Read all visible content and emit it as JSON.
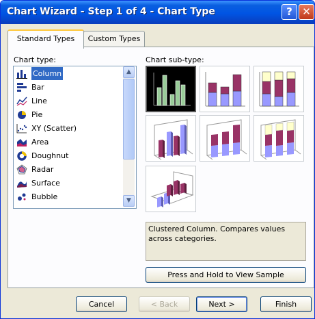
{
  "window": {
    "title": "Chart Wizard - Step 1 of 4 - Chart Type",
    "help_glyph": "?",
    "close_glyph": "✕"
  },
  "tabs": [
    {
      "label": "Standard Types",
      "active": true
    },
    {
      "label": "Custom Types",
      "active": false
    }
  ],
  "chart_type": {
    "label": "Chart type:",
    "items": [
      {
        "label": "Column",
        "icon": "column-chart-icon",
        "selected": true
      },
      {
        "label": "Bar",
        "icon": "bar-chart-icon"
      },
      {
        "label": "Line",
        "icon": "line-chart-icon"
      },
      {
        "label": "Pie",
        "icon": "pie-chart-icon"
      },
      {
        "label": "XY (Scatter)",
        "icon": "scatter-chart-icon"
      },
      {
        "label": "Area",
        "icon": "area-chart-icon"
      },
      {
        "label": "Doughnut",
        "icon": "doughnut-chart-icon"
      },
      {
        "label": "Radar",
        "icon": "radar-chart-icon"
      },
      {
        "label": "Surface",
        "icon": "surface-chart-icon"
      },
      {
        "label": "Bubble",
        "icon": "bubble-chart-icon"
      }
    ]
  },
  "chart_subtype": {
    "label": "Chart sub-type:",
    "selected": "Clustered Column",
    "options": [
      "clustered-column",
      "stacked-column",
      "100-stacked-column",
      "3d-clustered-column",
      "3d-stacked-column",
      "3d-100-stacked-column",
      "3d-column"
    ]
  },
  "description": "Clustered Column. Compares values across categories.",
  "sample_button": "Press and Hold to View Sample",
  "buttons": {
    "cancel": "Cancel",
    "back": "< Back",
    "next": "Next >",
    "finish": "Finish"
  },
  "colors": {
    "title_bar": "#0054e3",
    "selection": "#316ac5",
    "series1": "#9999ff",
    "series2": "#993366",
    "series3": "#ffffcc",
    "selected_bars": "#99cc99"
  }
}
